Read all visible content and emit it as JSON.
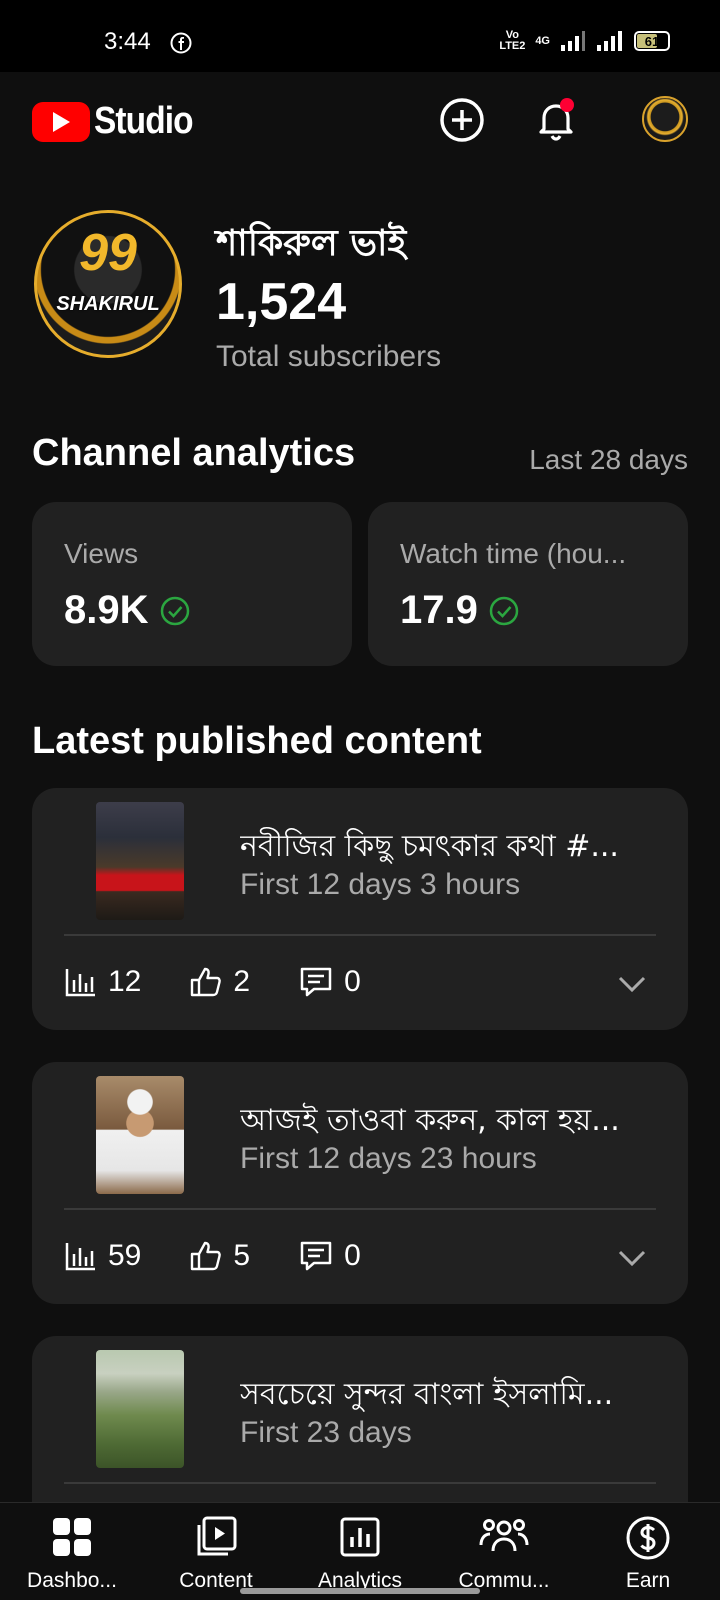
{
  "status_bar": {
    "time": "3:44",
    "network": "Vo LTE2",
    "signal_type": "4G",
    "battery": "61"
  },
  "header": {
    "app_name": "Studio",
    "brand_color": "#ff0000"
  },
  "channel": {
    "name": "শাকিরুল ভাই",
    "avatar_text": "SHAKIRUL",
    "avatar_number": "99",
    "subscriber_count": "1,524",
    "subscriber_label": "Total subscribers"
  },
  "analytics": {
    "title": "Channel analytics",
    "range": "Last 28 days",
    "metrics": [
      {
        "label": "Views",
        "value": "8.9K"
      },
      {
        "label": "Watch time (hou...",
        "value": "17.9"
      }
    ]
  },
  "latest": {
    "title": "Latest published content",
    "items": [
      {
        "title": "নবীজির কিছু চমৎকার কথা #...",
        "subtitle": "First 12 days 3 hours",
        "views": "12",
        "likes": "2",
        "comments": "0"
      },
      {
        "title": "আজই তাওবা করুন, কাল হয়...",
        "subtitle": "First 12 days 23 hours",
        "views": "59",
        "likes": "5",
        "comments": "0"
      },
      {
        "title": "সবচেয়ে সুন্দর বাংলা ইসলামি...",
        "subtitle": "First 23 days"
      }
    ]
  },
  "bottom_nav": {
    "items": [
      {
        "label": "Dashbo...",
        "icon": "dashboard-icon"
      },
      {
        "label": "Content",
        "icon": "content-icon"
      },
      {
        "label": "Analytics",
        "icon": "analytics-icon"
      },
      {
        "label": "Commu...",
        "icon": "community-icon"
      },
      {
        "label": "Earn",
        "icon": "earn-icon"
      }
    ]
  }
}
